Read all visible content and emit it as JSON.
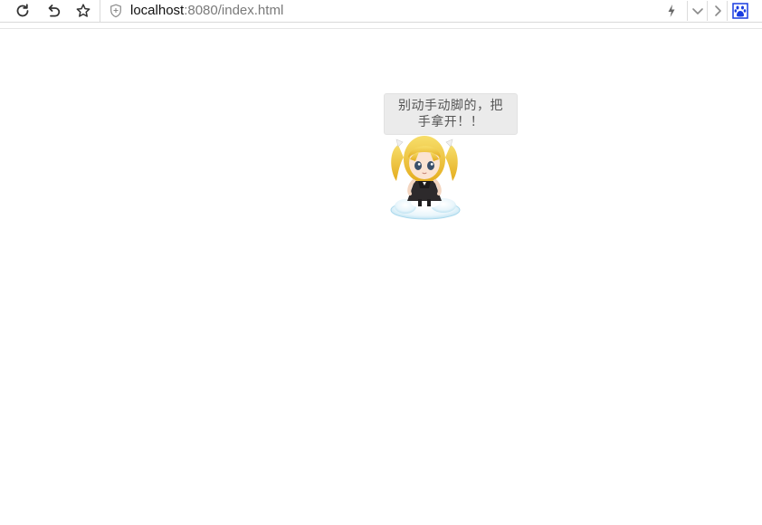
{
  "browser": {
    "url_host": "localhost",
    "url_rest": ":8080/index.html",
    "icons": {
      "reload": "reload-icon",
      "undo": "undo-icon",
      "favorite": "star-icon",
      "security": "shield-icon",
      "speed": "lightning-icon",
      "dropdown": "chevron-down-icon",
      "forward": "chevron-right-icon",
      "extension": "baidu-paw-icon"
    }
  },
  "widget": {
    "message": "别动手动脚的，把手拿开！！",
    "character": "anime-mascot-on-cloud"
  },
  "colors": {
    "bubble_bg": "#ebebeb",
    "bubble_text": "#555555",
    "extension_blue": "#1a3de0"
  }
}
